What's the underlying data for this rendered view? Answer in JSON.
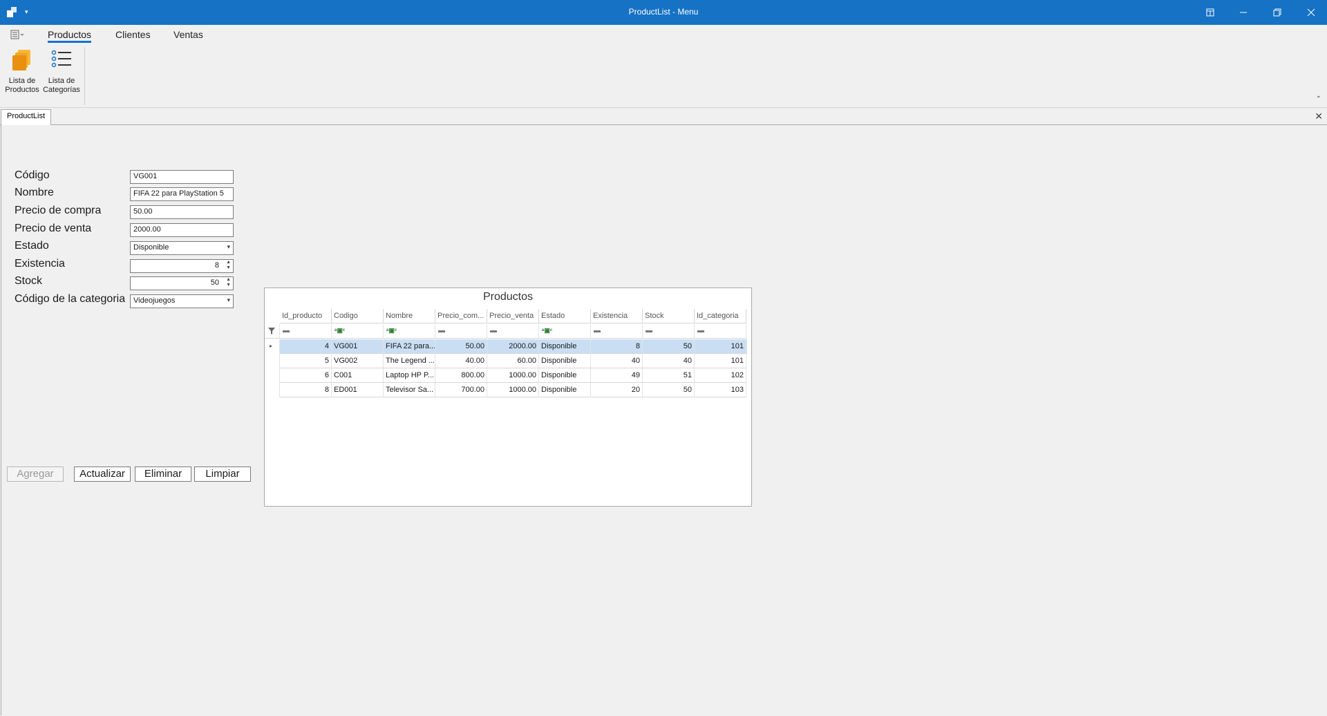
{
  "window": {
    "title": "ProductList - Menu",
    "accent": "#1672c4"
  },
  "ribbon": {
    "tabs": [
      {
        "label": "Productos",
        "active": true
      },
      {
        "label": "Clientes",
        "active": false
      },
      {
        "label": "Ventas",
        "active": false
      }
    ],
    "buttons": [
      {
        "label": "Lista de Productos",
        "icon": "products-folder-icon"
      },
      {
        "label": "Lista de Categorías",
        "icon": "list-icon"
      }
    ]
  },
  "doc_tab": {
    "label": "ProductList"
  },
  "form": {
    "labels": {
      "codigo": "Código",
      "nombre": "Nombre",
      "precio_compra": "Precio de compra",
      "precio_venta": "Precio de venta",
      "estado": "Estado",
      "existencia": "Existencia",
      "stock": "Stock",
      "categoria": "Código de la categoria"
    },
    "values": {
      "codigo": "VG001",
      "nombre": "FIFA 22 para PlayStation 5",
      "precio_compra": "50.00",
      "precio_venta": "2000.00",
      "estado": "Disponible",
      "existencia": "8",
      "stock": "50",
      "categoria": "Videojuegos"
    },
    "buttons": {
      "agregar": "Agregar",
      "actualizar": "Actualizar",
      "eliminar": "Eliminar",
      "limpiar": "Limpiar"
    }
  },
  "grid": {
    "title": "Productos",
    "columns": [
      "Id_producto",
      "Codigo",
      "Nombre",
      "Precio_com...",
      "Precio_venta",
      "Estado",
      "Existencia",
      "Stock",
      "Id_categoria"
    ],
    "rows": [
      [
        "4",
        "VG001",
        "FIFA 22 para...",
        "50.00",
        "2000.00",
        "Disponible",
        "8",
        "50",
        "101"
      ],
      [
        "5",
        "VG002",
        "The Legend ...",
        "40.00",
        "60.00",
        "Disponible",
        "40",
        "40",
        "101"
      ],
      [
        "6",
        "C001",
        "Laptop HP P...",
        "800.00",
        "1000.00",
        "Disponible",
        "49",
        "51",
        "102"
      ],
      [
        "8",
        "ED001",
        "Televisor Sa...",
        "700.00",
        "1000.00",
        "Disponible",
        "20",
        "50",
        "103"
      ]
    ],
    "selected_row": 0
  }
}
